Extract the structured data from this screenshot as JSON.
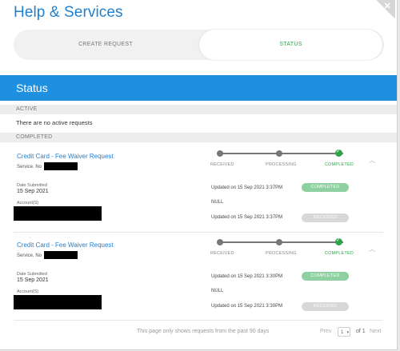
{
  "header": {
    "title": "Help & Services",
    "close_glyph": "✕"
  },
  "tabs": [
    {
      "label": "CREATE REQUEST",
      "selected": false
    },
    {
      "label": "STATUS",
      "selected": true
    }
  ],
  "status_section": {
    "title": "Status"
  },
  "active": {
    "header": "ACTIVE",
    "empty_text": "There are no active requests"
  },
  "completed": {
    "header": "COMPLETED",
    "requests": [
      {
        "title": "Credit Card - Fee Waiver Request",
        "service_label": "Service. No",
        "date_label": "Date Submitted",
        "date": "15 Sep 2021",
        "account_label": "Account(S)",
        "steps": [
          "RECEIVED",
          "PROCESSING",
          "COMPLETED"
        ],
        "updated_1": "Updated on 15 Sep 2021 3:37PM",
        "status_1": "COMPLETED",
        "null_text": "NULL",
        "updated_2": "Updated on 15 Sep 2021 3:37PM",
        "status_2": "RECEIVED"
      },
      {
        "title": "Credit Card - Fee Waiver Request",
        "service_label": "Service. No",
        "date_label": "Date Submitted",
        "date": "15 Sep 2021",
        "account_label": "Account(S)",
        "steps": [
          "RECEIVED",
          "PROCESSING",
          "COMPLETED"
        ],
        "updated_1": "Updated on 15 Sep 2021 3:30PM",
        "status_1": "COMPLETED",
        "null_text": "NULL",
        "updated_2": "Updated on 15 Sep 2021 3:30PM",
        "status_2": "RECEIVED"
      }
    ]
  },
  "footer": {
    "note": "This page only shows requests from the past 90 days",
    "prev": "Prev",
    "page": "1",
    "of_text": "of 1",
    "next": "Next"
  },
  "colors": {
    "accent": "#1f8fe0",
    "success": "#2fa24a",
    "link": "#1f7fd0"
  }
}
